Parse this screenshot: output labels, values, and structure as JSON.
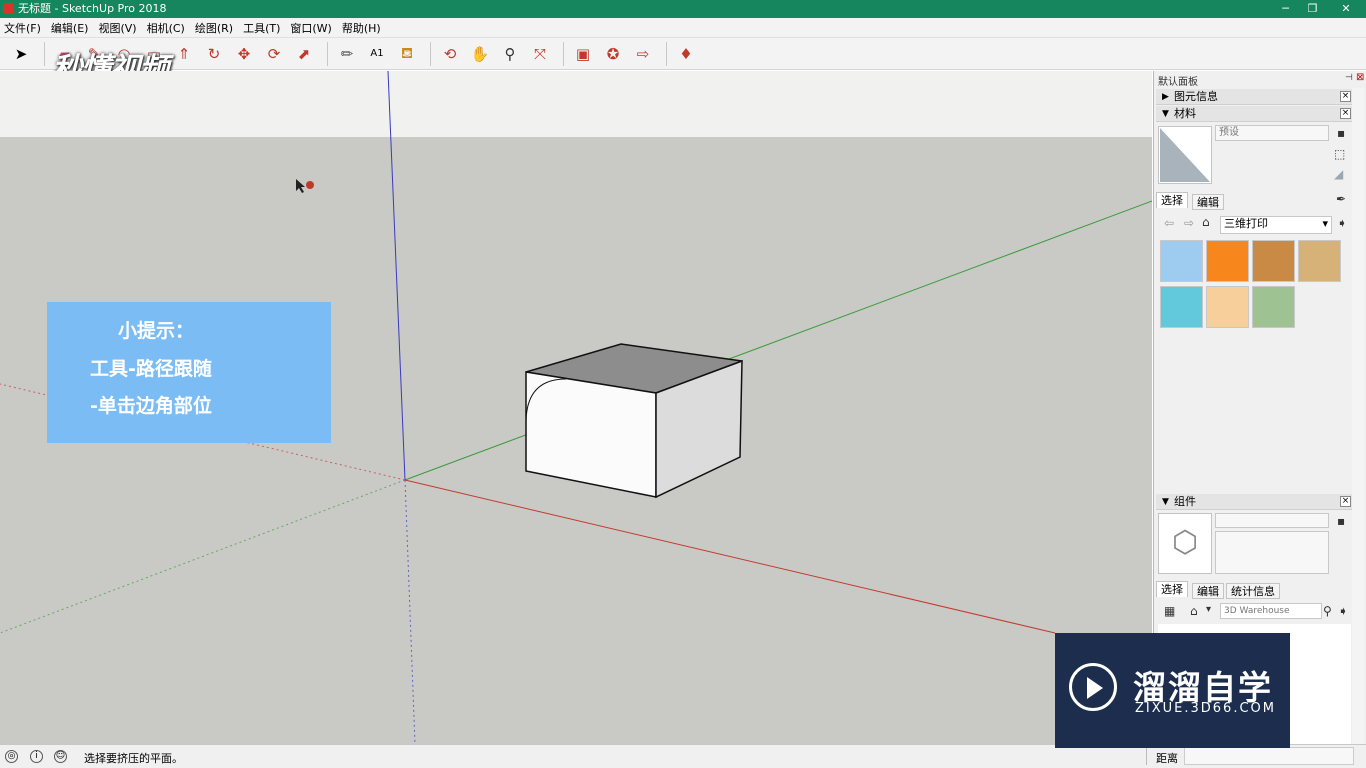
{
  "window": {
    "title": "无标题 - SketchUp Pro 2018"
  },
  "menu": [
    "文件(F)",
    "编辑(E)",
    "视图(V)",
    "相机(C)",
    "绘图(R)",
    "工具(T)",
    "窗口(W)",
    "帮助(H)"
  ],
  "toolbar": {
    "icons": [
      "select-icon",
      "eraser-icon",
      "pencil-icon",
      "arc-icon",
      "rectangle-icon",
      "push-pull-icon",
      "follow-me-icon",
      "move-icon",
      "rotate-icon",
      "scale-icon",
      "tape-measure-icon",
      "text-icon",
      "paint-bucket-icon",
      "orbit-icon",
      "pan-icon",
      "zoom-icon",
      "zoom-extents-icon",
      "warehouse-icon",
      "extension-icon",
      "share-icon",
      "ruby-icon"
    ]
  },
  "video_logo": "秒懂视频",
  "tip": {
    "line1": "小提示：",
    "line2": "工具-路径跟随",
    "line3": "-单击边角部位"
  },
  "panel": {
    "title": "默认面板",
    "entity_info": "图元信息",
    "materials": {
      "header": "材料",
      "name_placeholder": "预设",
      "tabs": [
        "选择",
        "编辑"
      ],
      "library": "三维打印",
      "swatch_colors": [
        "#9ecbf0",
        "#f7871c",
        "#c98a45",
        "#d6b178",
        "#62c8dc",
        "#f6cf9a",
        "#9fc293"
      ]
    },
    "components": {
      "header": "组件",
      "tabs": [
        "选择",
        "编辑",
        "统计信息"
      ],
      "search_placeholder": "3D Warehouse"
    }
  },
  "status": {
    "message": "选择要挤压的平面。",
    "measure_label": "距离"
  },
  "brand": {
    "name": "溜溜自学",
    "url": "ZIXUE.3D66.COM"
  },
  "colors": {
    "titlebar": "#16865f",
    "axis_red": "#c23b2e",
    "axis_green": "#3c9a3c",
    "axis_blue": "#3a3ac0"
  }
}
